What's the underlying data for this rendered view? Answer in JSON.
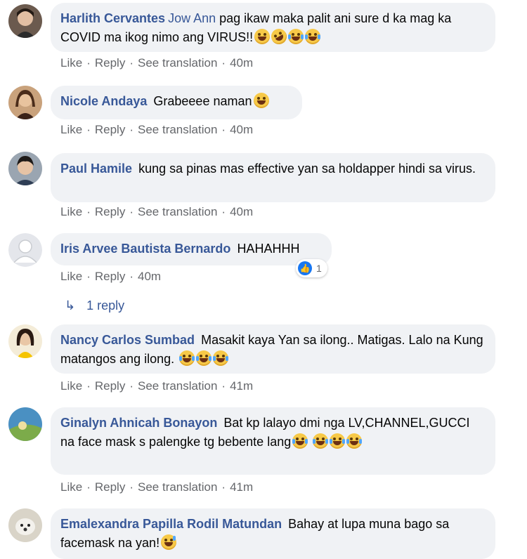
{
  "comments": [
    {
      "author": "Harlith Cervantes",
      "mention": "Jow Ann",
      "text": "pag ikaw maka palit ani sure d ka mag ka COVID ma ikog nimo ang VIRUS!!",
      "emojis": [
        "laughing-face",
        "rolling-laugh-face",
        "tears-of-joy-face",
        "tears-of-joy-face"
      ],
      "actions": [
        "Like",
        "Reply",
        "See translation",
        "40m"
      ]
    },
    {
      "author": "Nicole Andaya",
      "text": "Grabeeee naman",
      "emojis": [
        "laughing-face"
      ],
      "actions": [
        "Like",
        "Reply",
        "See translation",
        "40m"
      ]
    },
    {
      "author": "Paul Hamile",
      "text": "kung sa pinas mas effective yan sa holdapper hindi sa virus.",
      "emojis": [],
      "actions": [
        "Like",
        "Reply",
        "See translation",
        "40m"
      ]
    },
    {
      "author": "Iris Arvee Bautista Bernardo",
      "text": "HAHAHHH",
      "emojis": [],
      "actions": [
        "Like",
        "Reply",
        "40m"
      ],
      "reaction_count": "1",
      "replies_label": "1 reply"
    },
    {
      "author": "Nancy Carlos Sumbad",
      "text": "Masakit kaya Yan sa ilong.. Matigas. Lalo na Kung matangos ang ilong.",
      "emojis": [
        "tears-of-joy-face",
        "tears-of-joy-face",
        "tears-of-joy-face"
      ],
      "actions": [
        "Like",
        "Reply",
        "See translation",
        "41m"
      ]
    },
    {
      "author": "Ginalyn Ahnicah Bonayon",
      "text": "Bat kp lalayo dmi nga LV,CHANNEL,GUCCI na face mask s palengke tg bebente lang",
      "emojis": [
        "tears-of-joy-face",
        "tears-of-joy-face",
        "tears-of-joy-face",
        "tears-of-joy-face"
      ],
      "actions": [
        "Like",
        "Reply",
        "See translation",
        "41m"
      ]
    },
    {
      "author": "Emalexandra Papilla Rodil Matundan",
      "text": "Bahay at lupa muna bago sa facemask na yan!",
      "emojis": [
        "grinning-sweat-face"
      ],
      "actions": []
    }
  ],
  "colors": {
    "author": "#385898",
    "bubble": "#f0f2f5",
    "meta": "#65676b",
    "like_badge": "#1877f2"
  }
}
